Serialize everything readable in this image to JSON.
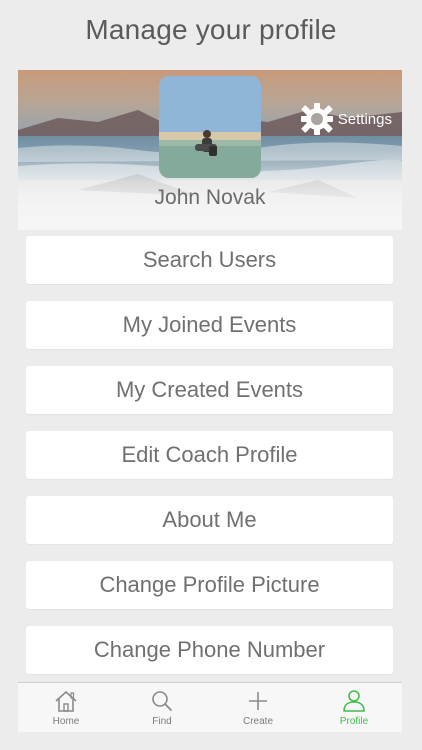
{
  "header": {
    "title": "Manage your profile"
  },
  "profile": {
    "name": "John Novak",
    "settings_label": "Settings"
  },
  "menu": {
    "items": [
      {
        "label": "Search Users"
      },
      {
        "label": "My Joined Events"
      },
      {
        "label": "My Created Events"
      },
      {
        "label": "Edit Coach Profile"
      },
      {
        "label": "About Me"
      },
      {
        "label": "Change Profile Picture"
      },
      {
        "label": "Change Phone Number"
      }
    ]
  },
  "tabbar": {
    "tabs": [
      {
        "label": "Home",
        "icon": "home-icon"
      },
      {
        "label": "Find",
        "icon": "search-icon"
      },
      {
        "label": "Create",
        "icon": "plus-icon"
      },
      {
        "label": "Profile",
        "icon": "person-icon",
        "active": true
      }
    ]
  },
  "colors": {
    "accent": "#3fbf4a",
    "text": "#707070",
    "background": "#ececec"
  }
}
